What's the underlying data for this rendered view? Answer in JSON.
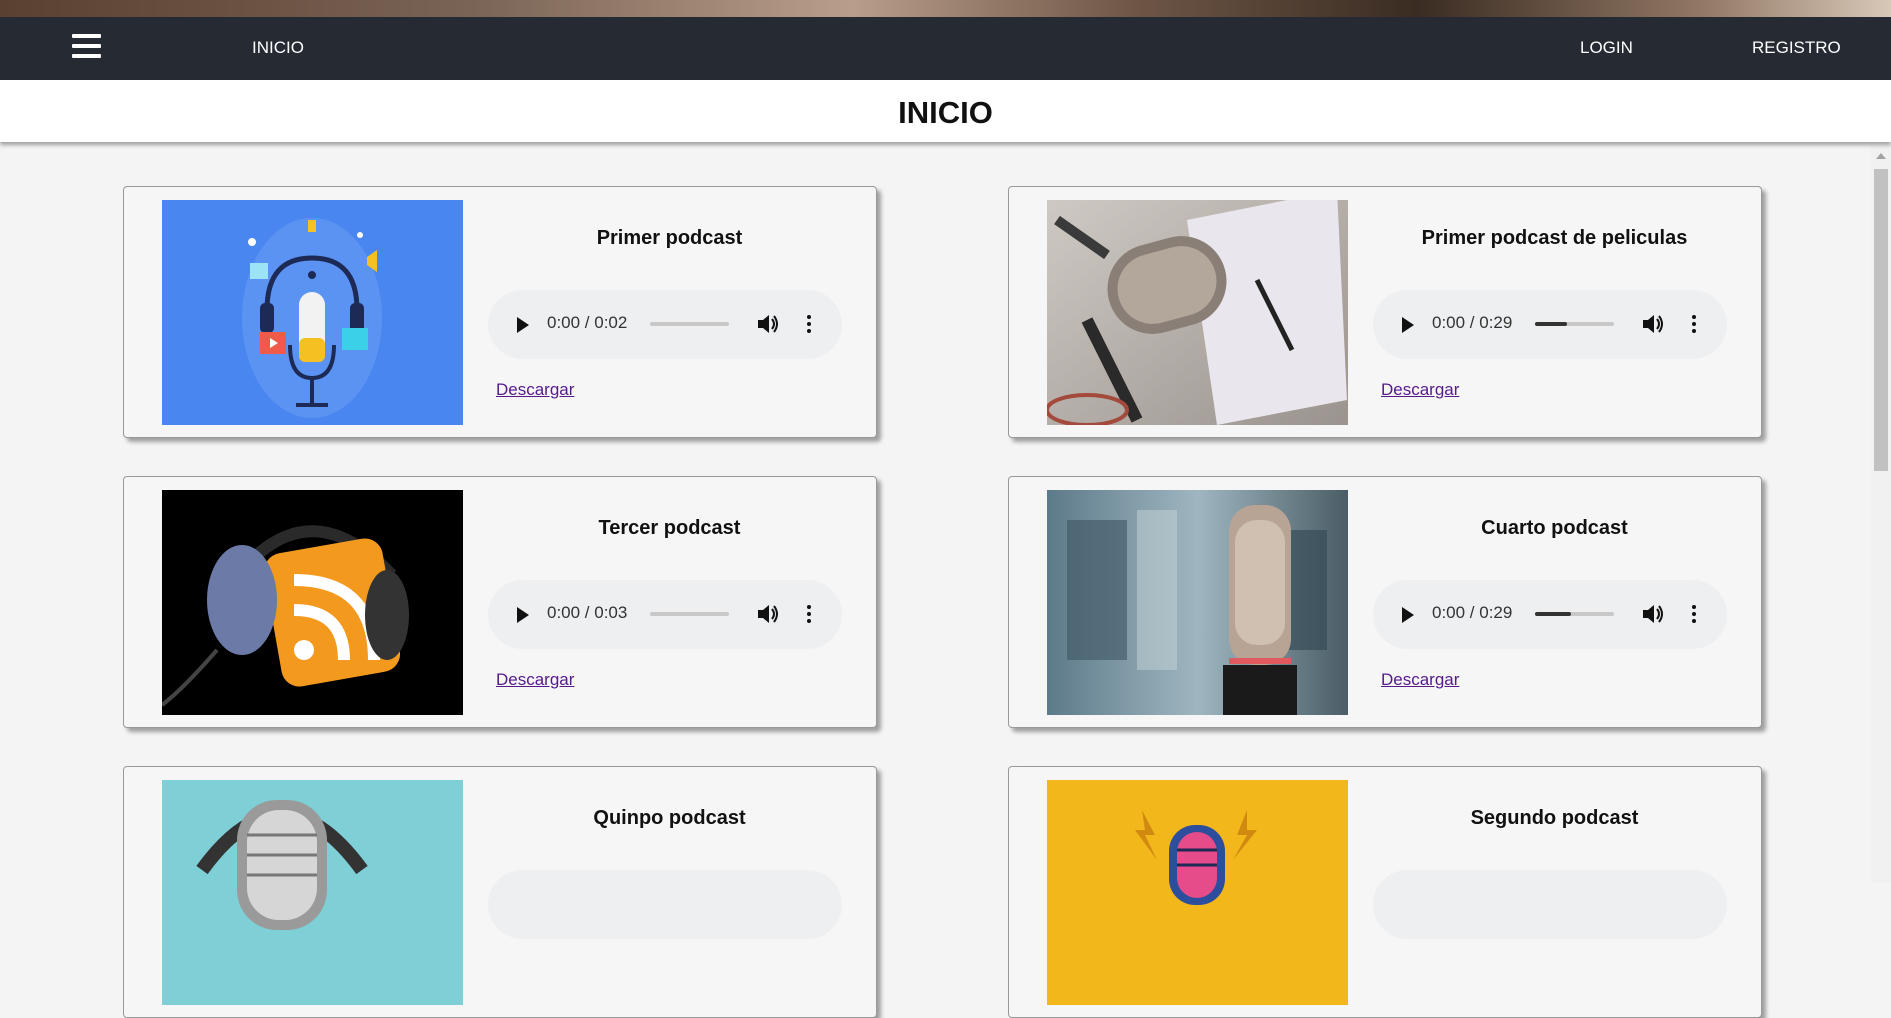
{
  "nav": {
    "home": "INICIO",
    "login": "LOGIN",
    "register": "REGISTRO",
    "menu_icon": "hamburger-menu-icon"
  },
  "page": {
    "title": "INICIO"
  },
  "cards": [
    {
      "title": "Primer podcast",
      "time": "0:00 / 0:02",
      "progress": 0.0,
      "download": "Descargar",
      "image": "podcast-illustration-blue"
    },
    {
      "title": "Primer podcast de peliculas",
      "time": "0:00 / 0:29",
      "progress": 0.4,
      "download": "Descargar",
      "image": "studio-microphone-notebook-photo"
    },
    {
      "title": "Tercer podcast",
      "time": "0:00 / 0:03",
      "progress": 0.0,
      "download": "Descargar",
      "image": "rss-headphones-icon"
    },
    {
      "title": "Cuarto podcast",
      "time": "0:00 / 0:29",
      "progress": 0.45,
      "download": "Descargar",
      "image": "condenser-microphone-photo"
    },
    {
      "title": "Quinpo podcast",
      "image": "vintage-microphone-headphones-photo"
    },
    {
      "title": "Segundo podcast",
      "image": "retro-microphone-yellow-illustration"
    }
  ]
}
